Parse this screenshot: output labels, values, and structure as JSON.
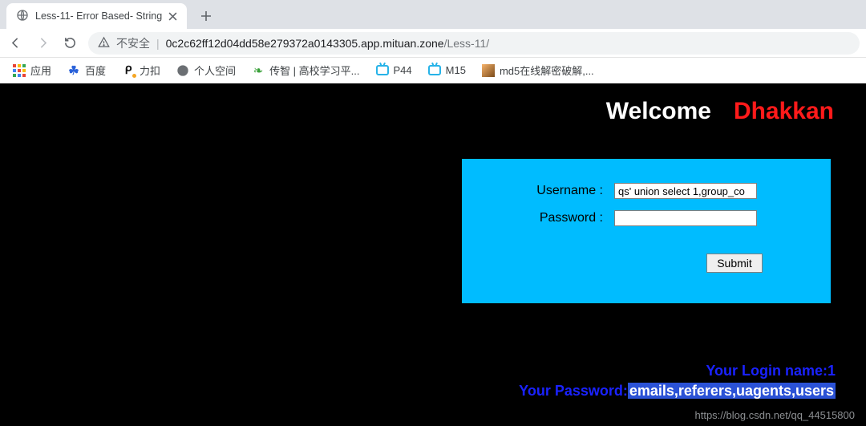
{
  "browser": {
    "tab_title": "Less-11- Error Based- String",
    "insecure_label": "不安全",
    "url_host": "0c2c62ff12d04dd58e279372a0143305.app.mituan.zone",
    "url_path": "/Less-11/"
  },
  "bookmarks": {
    "apps": "应用",
    "baidu": "百度",
    "likou": "力扣",
    "space": "个人空间",
    "chuanzhi": "传智 | 高校学习平...",
    "p44": "P44",
    "m15": "M15",
    "md5": "md5在线解密破解,..."
  },
  "page": {
    "welcome": "Welcome",
    "brand": "Dhakkan",
    "form": {
      "username_label": "Username :",
      "password_label": "Password :",
      "username_value": "qs' union select 1,group_co",
      "password_value": "",
      "submit": "Submit"
    },
    "result": {
      "line1_prefix": "Your Login name:",
      "line1_value": "1",
      "line2_prefix": "Your Password:",
      "line2_value": "emails,referers,uagents,users"
    },
    "watermark": "https://blog.csdn.net/qq_44515800"
  }
}
